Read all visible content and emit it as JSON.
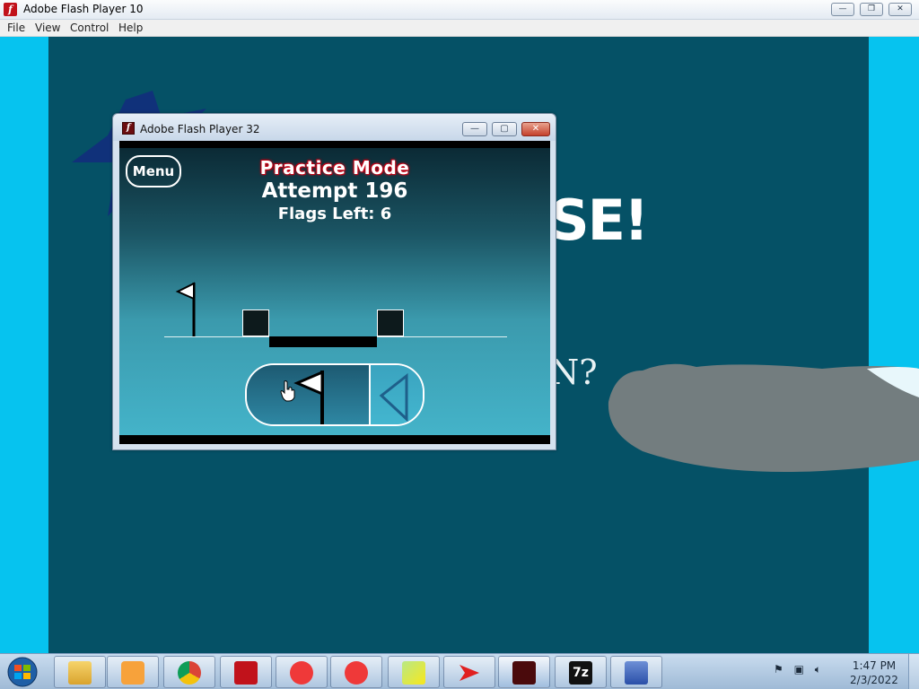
{
  "main_window": {
    "title": "Adobe Flash Player 10",
    "menu": [
      "File",
      "View",
      "Control",
      "Help"
    ],
    "controls": {
      "minimize": "—",
      "maximize": "❐",
      "close": "✕"
    }
  },
  "background": {
    "headline_fragment": "SE!",
    "subtitle_fragment": "N?"
  },
  "dialog": {
    "title": "Adobe Flash Player 32",
    "controls": {
      "minimize": "—",
      "maximize": "▢",
      "close": "✕"
    }
  },
  "game": {
    "menu_button": "Menu",
    "mode": "Practice Mode",
    "attempt": "Attempt 196",
    "flags_left": "Flags Left: 6"
  },
  "taskbar": {
    "apps": [
      "windows-explorer",
      "media-player",
      "chrome",
      "flash-player",
      "vivaldi",
      "vivaldi",
      "sticky-notes",
      "arrow-app",
      "flash-player-active",
      "7-zip",
      "remote-tool"
    ],
    "time": "1:47 PM",
    "date": "2/3/2022"
  },
  "colors": {
    "stage_bg": "#055166",
    "side_cyan": "#06c3ef",
    "practice_red": "#c20014"
  }
}
